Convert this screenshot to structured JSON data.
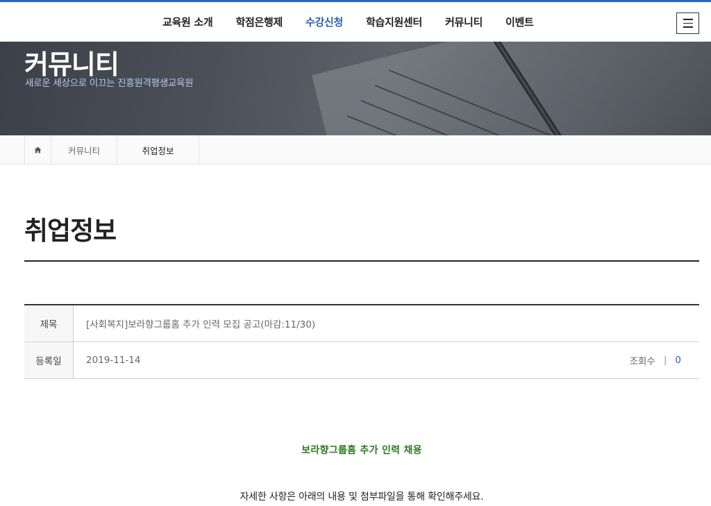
{
  "nav": {
    "items": [
      {
        "label": "교육원 소개"
      },
      {
        "label": "학점은행제"
      },
      {
        "label": "수강신청"
      },
      {
        "label": "학습지원센터"
      },
      {
        "label": "커뮤니티"
      },
      {
        "label": "이벤트"
      }
    ],
    "active_index": 2,
    "menu_icon": "hamburger-menu-icon"
  },
  "hero": {
    "title": "커뮤니티",
    "subtitle": "새로운 세상으로 이끄는 진흥원격평생교육원"
  },
  "breadcrumb": {
    "home_icon": "home-icon",
    "items": [
      "커뮤니티",
      "취업정보"
    ]
  },
  "page": {
    "title": "취업정보"
  },
  "post": {
    "subject_label": "제목",
    "subject": "[사회복지]보라향그룹홈 추가 인력 모집 공고(마감:11/30)",
    "date_label": "등록일",
    "date": "2019-11-14",
    "views_label": "조회수",
    "views_separator": "|",
    "views": "0"
  },
  "content": {
    "heading": "보라향그룹홈 추가 인력 채용",
    "body": "자세한 사항은 아래의 내용 및 첨부파일을 통해 확인해주세요."
  },
  "colors": {
    "accent": "#2a63c8",
    "active_nav": "#2d5fbf",
    "heading_green": "#2b7a1e"
  }
}
